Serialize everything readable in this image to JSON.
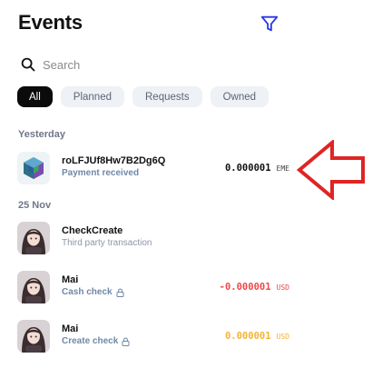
{
  "header": {
    "title": "Events",
    "filter_icon": "filter-icon"
  },
  "search": {
    "placeholder": "Search",
    "icon": "search-icon"
  },
  "tabs": [
    {
      "label": "All",
      "active": true
    },
    {
      "label": "Planned",
      "active": false
    },
    {
      "label": "Requests",
      "active": false
    },
    {
      "label": "Owned",
      "active": false
    }
  ],
  "sections": [
    {
      "label": "Yesterday"
    },
    {
      "label": "25 Nov"
    }
  ],
  "events": [
    {
      "name": "roLFJUf8Hw7B2Dg6Q",
      "subtitle": "Payment received",
      "amount": "0.000001",
      "currency": "EME",
      "amount_color": "#111111",
      "avatar": "token-logo"
    },
    {
      "name": "CheckCreate",
      "subtitle": "Third party transaction",
      "amount": "",
      "currency": "",
      "amount_color": "#111111",
      "avatar": "user-avatar"
    },
    {
      "name": "Mai",
      "subtitle": "Cash check",
      "amount": "-0.000001",
      "currency": "USD",
      "amount_color": "#f0484a",
      "avatar": "user-avatar",
      "lock_icon": "lock-icon"
    },
    {
      "name": "Mai",
      "subtitle": "Create check",
      "amount": "0.000001",
      "currency": "USD",
      "amount_color": "#f4b331",
      "avatar": "user-avatar",
      "lock_icon": "lock-icon"
    }
  ],
  "colors": {
    "accent": "#2a36e0",
    "annotation_arrow": "#e02424",
    "negative": "#f0484a",
    "pending": "#f4b331"
  }
}
